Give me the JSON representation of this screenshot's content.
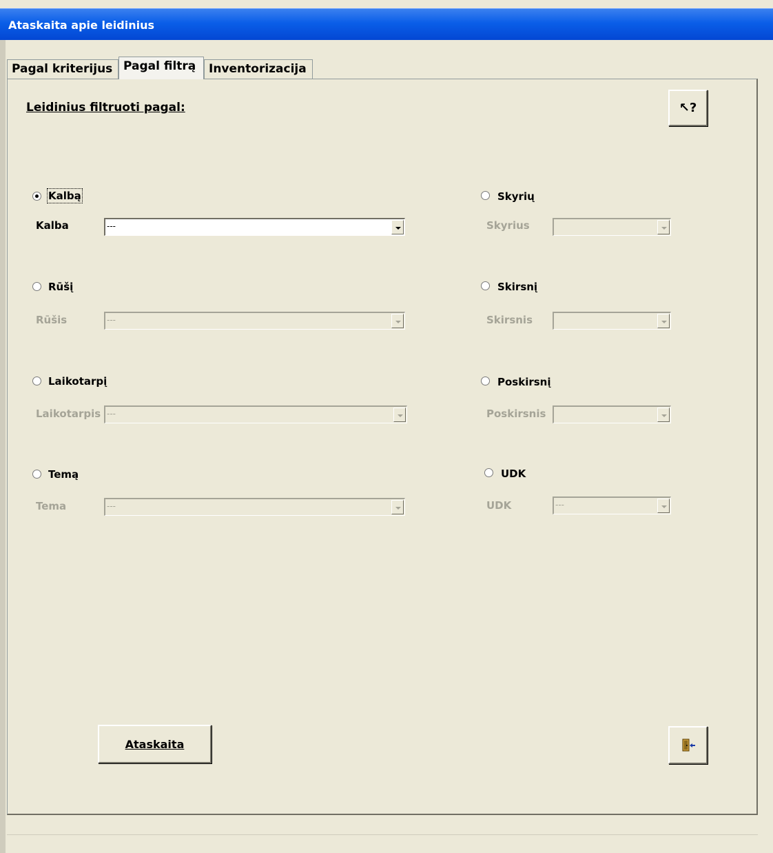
{
  "window": {
    "title": "Ataskaita apie leidinius"
  },
  "tabs": [
    {
      "label": "Pagal kriterijus",
      "active": false
    },
    {
      "label": "Pagal filtrą",
      "active": true
    },
    {
      "label": "Inventorizacija",
      "active": false
    }
  ],
  "panel": {
    "header": "Leidinius filtruoti pagal:",
    "help_button_glyph": "↖?",
    "report_button_label": "Ataskaita",
    "exit_icon": "exit-door-icon"
  },
  "filters_left": [
    {
      "radio_label": "Kalbą",
      "field_label": "Kalba",
      "value": "---",
      "selected": true,
      "enabled": true
    },
    {
      "radio_label": "Rūšį",
      "field_label": "Rūšis",
      "value": "---",
      "selected": false,
      "enabled": false
    },
    {
      "radio_label": "Laikotarpį",
      "field_label": "Laikotarpis",
      "value": "---",
      "selected": false,
      "enabled": false
    },
    {
      "radio_label": "Temą",
      "field_label": "Tema",
      "value": "---",
      "selected": false,
      "enabled": false
    }
  ],
  "filters_right": [
    {
      "radio_label": "Skyrių",
      "field_label": "Skyrius",
      "value": "",
      "selected": false,
      "enabled": false
    },
    {
      "radio_label": "Skirsnį",
      "field_label": "Skirsnis",
      "value": "",
      "selected": false,
      "enabled": false
    },
    {
      "radio_label": "Poskirsnį",
      "field_label": "Poskirsnis",
      "value": "",
      "selected": false,
      "enabled": false
    },
    {
      "radio_label": "UDK",
      "field_label": "UDK",
      "value": "---",
      "selected": false,
      "enabled": false
    }
  ]
}
